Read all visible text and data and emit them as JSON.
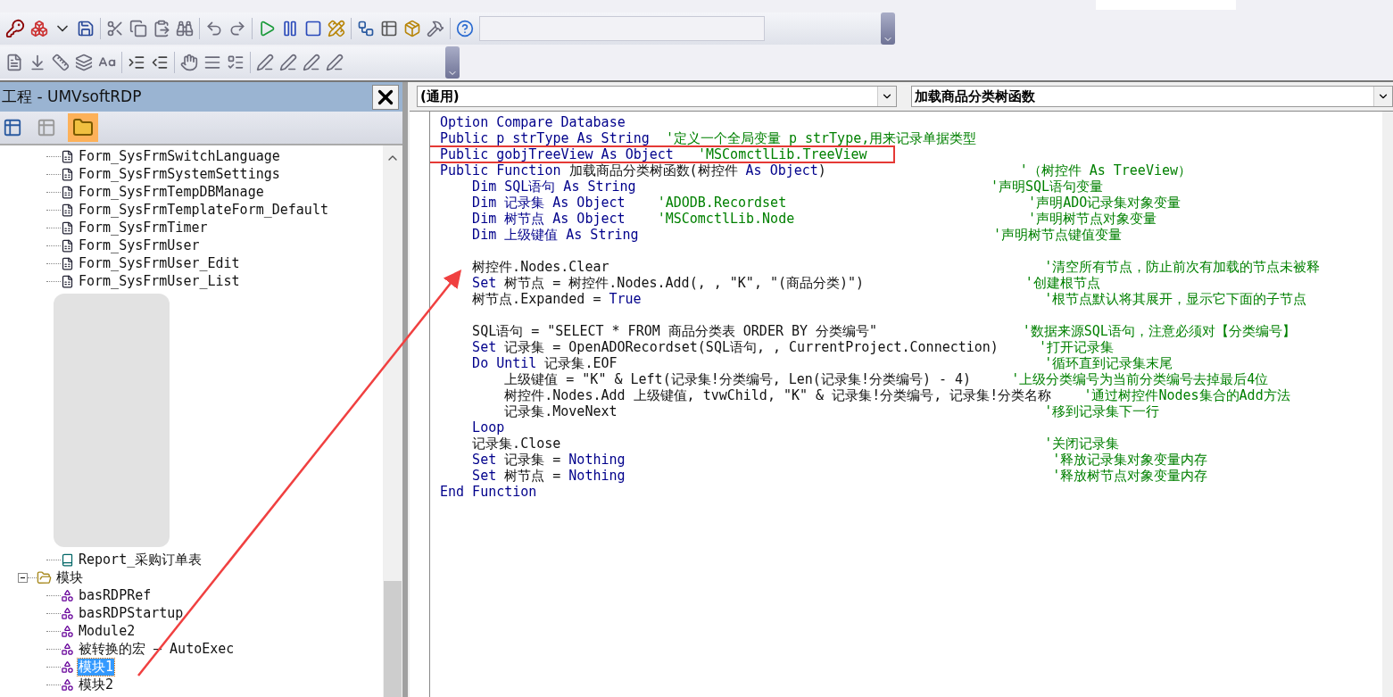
{
  "project_explorer": {
    "title": "工程 - UMVsoftRDP",
    "tree": [
      {
        "kind": "form",
        "label": "Form_SysFrmSwitchLanguage",
        "selected": false
      },
      {
        "kind": "form",
        "label": "Form_SysFrmSystemSettings",
        "selected": false
      },
      {
        "kind": "form",
        "label": "Form_SysFrmTempDBManage",
        "selected": false
      },
      {
        "kind": "form",
        "label": "Form_SysFrmTemplateForm_Default",
        "selected": false
      },
      {
        "kind": "form",
        "label": "Form_SysFrmTimer",
        "selected": false
      },
      {
        "kind": "form",
        "label": "Form_SysFrmUser",
        "selected": false
      },
      {
        "kind": "form",
        "label": "Form_SysFrmUser_Edit",
        "selected": false
      },
      {
        "kind": "form",
        "label": "Form_SysFrmUser_List",
        "selected": false
      },
      {
        "kind": "report",
        "label": "Report_采购订单表",
        "selected": false
      },
      {
        "kind": "folder",
        "label": "模块",
        "expanded": true,
        "selected": false,
        "children": [
          {
            "kind": "module",
            "label": "basRDPRef",
            "selected": false
          },
          {
            "kind": "module",
            "label": "basRDPStartup",
            "selected": false
          },
          {
            "kind": "module",
            "label": "Module2",
            "selected": false
          },
          {
            "kind": "module",
            "label": "被转换的宏 — AutoExec",
            "selected": false
          },
          {
            "kind": "module",
            "label": "模块1",
            "selected": true
          },
          {
            "kind": "module",
            "label": "模块2",
            "selected": false
          }
        ]
      }
    ]
  },
  "code_window": {
    "object_combo": "(通用)",
    "procedure_combo": "加载商品分类树函数",
    "lines": [
      {
        "highlighted": false,
        "segments": [
          {
            "kind": "keyword",
            "text": "Option Compare Database"
          }
        ]
      },
      {
        "highlighted": false,
        "segments": [
          {
            "kind": "keyword",
            "text": "Public p_strType As String  "
          },
          {
            "kind": "comment",
            "text": "'定义一个全局变量 p_strType,用来记录单据类型"
          }
        ]
      },
      {
        "highlighted": true,
        "segments": [
          {
            "kind": "keyword",
            "text": "Public gobjTreeView As Object   "
          },
          {
            "kind": "comment",
            "text": "'MSComctlLib.TreeView"
          }
        ]
      },
      {
        "highlighted": false,
        "segments": [
          {
            "kind": "keyword",
            "text": "Public Function "
          },
          {
            "kind": "plain",
            "text": "加载商品分类树函数(树控件"
          },
          {
            "kind": "keyword",
            "text": " As Object"
          },
          {
            "kind": "plain",
            "text": ")                        "
          },
          {
            "kind": "comment",
            "text": "'（树控件 As TreeView）"
          }
        ]
      },
      {
        "highlighted": false,
        "segments": [
          {
            "kind": "keyword",
            "text": "    Dim SQL语句 As String                                            "
          },
          {
            "kind": "comment",
            "text": "'声明SQL语句变量"
          }
        ]
      },
      {
        "highlighted": false,
        "segments": [
          {
            "kind": "keyword",
            "text": "    Dim 记录集 As Object    "
          },
          {
            "kind": "comment",
            "text": "'ADODB.Recordset                              '声明ADO记录集对象变量"
          }
        ]
      },
      {
        "highlighted": false,
        "segments": [
          {
            "kind": "keyword",
            "text": "    Dim 树节点 As Object    "
          },
          {
            "kind": "comment",
            "text": "'MSComctlLib.Node                             '声明树节点对象变量"
          }
        ]
      },
      {
        "highlighted": false,
        "segments": [
          {
            "kind": "keyword",
            "text": "    Dim 上级键值 As String                                            "
          },
          {
            "kind": "comment",
            "text": "'声明树节点键值变量"
          }
        ]
      },
      {
        "highlighted": false
      },
      {
        "highlighted": false,
        "segments": [
          {
            "kind": "plain",
            "text": "    树控件.Nodes.Clear                                                      "
          },
          {
            "kind": "comment",
            "text": "'清空所有节点，防止前次有加载的节点未被释"
          }
        ]
      },
      {
        "highlighted": false,
        "segments": [
          {
            "kind": "keyword",
            "text": "    Set "
          },
          {
            "kind": "plain",
            "text": "树节点 = 树控件.Nodes.Add(, , \"K\", \"(商品分类)\")                    "
          },
          {
            "kind": "comment",
            "text": "'创建根节点"
          }
        ]
      },
      {
        "highlighted": false,
        "segments": [
          {
            "kind": "plain",
            "text": "    树节点.Expanded = "
          },
          {
            "kind": "keyword",
            "text": "True                                                  "
          },
          {
            "kind": "comment",
            "text": "'根节点默认将其展开，显示它下面的子节点"
          }
        ]
      },
      {
        "highlighted": false
      },
      {
        "highlighted": false,
        "segments": [
          {
            "kind": "plain",
            "text": "    SQL语句 = \"SELECT * FROM 商品分类表 ORDER BY 分类编号\"                  "
          },
          {
            "kind": "comment",
            "text": "'数据来源SQL语句，注意必须对【分类编号】"
          }
        ]
      },
      {
        "highlighted": false,
        "segments": [
          {
            "kind": "keyword",
            "text": "    Set "
          },
          {
            "kind": "plain",
            "text": "记录集 = OpenADORecordset(SQL语句, , CurrentProject.Connection)     "
          },
          {
            "kind": "comment",
            "text": "'打开记录集"
          }
        ]
      },
      {
        "highlighted": false,
        "segments": [
          {
            "kind": "keyword",
            "text": "    Do Until "
          },
          {
            "kind": "plain",
            "text": "记录集.EOF                                                     "
          },
          {
            "kind": "comment",
            "text": "'循环直到记录集末尾"
          }
        ]
      },
      {
        "highlighted": false,
        "segments": [
          {
            "kind": "plain",
            "text": "        上级键值 = \"K\" & Left(记录集!分类编号, Len(记录集!分类编号) - 4)     "
          },
          {
            "kind": "comment",
            "text": "'上级分类编号为当前分类编号去掉最后4位"
          }
        ]
      },
      {
        "highlighted": false,
        "segments": [
          {
            "kind": "plain",
            "text": "        树控件.Nodes.Add 上级键值, tvwChild, \"K\" & 记录集!分类编号, 记录集!分类名称    "
          },
          {
            "kind": "comment",
            "text": "'通过树控件Nodes集合的Add方法"
          }
        ]
      },
      {
        "highlighted": false,
        "segments": [
          {
            "kind": "plain",
            "text": "        记录集.MoveNext                                                     "
          },
          {
            "kind": "comment",
            "text": "'移到记录集下一行"
          }
        ]
      },
      {
        "highlighted": false,
        "segments": [
          {
            "kind": "keyword",
            "text": "    Loop"
          }
        ]
      },
      {
        "highlighted": false,
        "segments": [
          {
            "kind": "plain",
            "text": "    记录集.Close                                                            "
          },
          {
            "kind": "comment",
            "text": "'关闭记录集"
          }
        ]
      },
      {
        "highlighted": false,
        "segments": [
          {
            "kind": "keyword",
            "text": "    Set "
          },
          {
            "kind": "plain",
            "text": "记录集 = "
          },
          {
            "kind": "keyword",
            "text": "Nothing                                                     "
          },
          {
            "kind": "comment",
            "text": "'释放记录集对象变量内存"
          }
        ]
      },
      {
        "highlighted": false,
        "segments": [
          {
            "kind": "keyword",
            "text": "    Set "
          },
          {
            "kind": "plain",
            "text": "树节点 = "
          },
          {
            "kind": "keyword",
            "text": "Nothing                                                     "
          },
          {
            "kind": "comment",
            "text": "'释放树节点对象变量内存"
          }
        ]
      },
      {
        "highlighted": false,
        "segments": [
          {
            "kind": "keyword",
            "text": "End Function"
          }
        ]
      }
    ]
  },
  "annotation_arrow": true
}
